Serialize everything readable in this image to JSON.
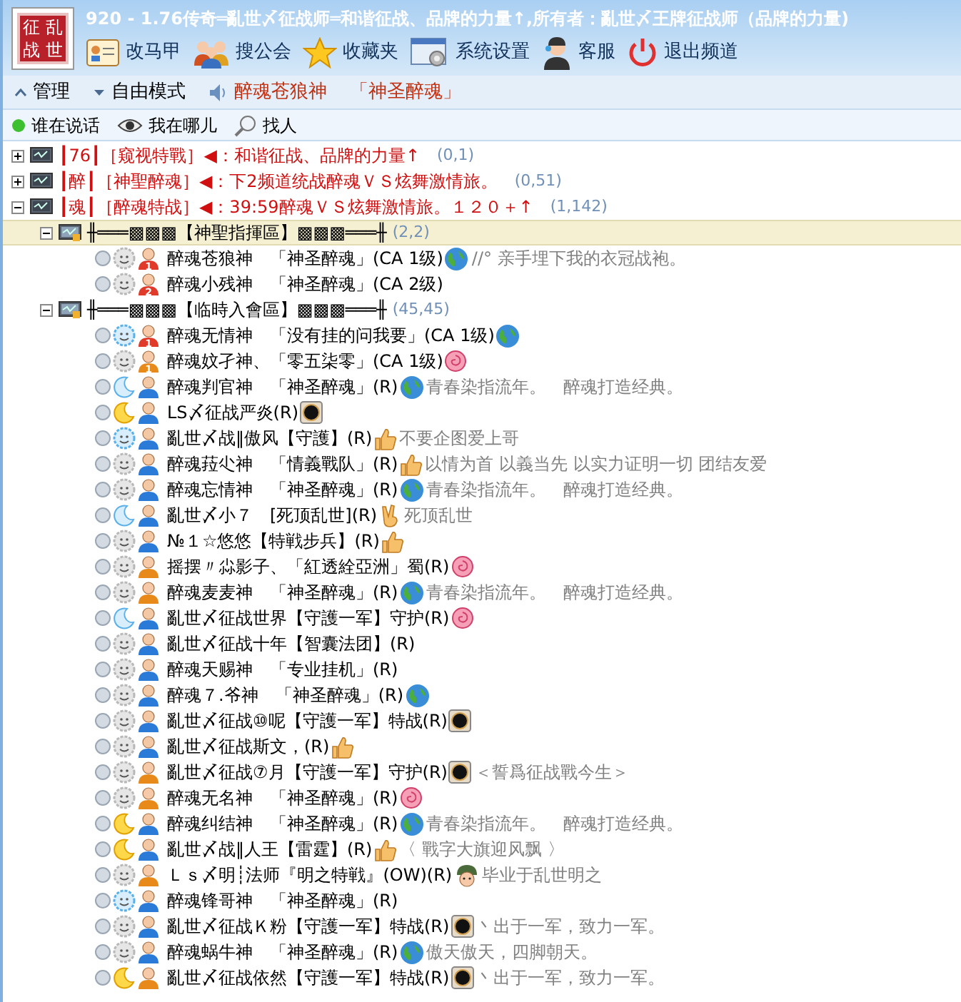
{
  "logo": {
    "chars": [
      "征",
      "乱",
      "战",
      "世"
    ]
  },
  "window": {
    "title": "920 - 1.76传奇═亂世〆征战师═和谐征战、品牌的力量↑,所有者：亂世〆王牌征战师（品牌的力量)"
  },
  "toolbar": [
    {
      "kind": "card",
      "label": "改马甲"
    },
    {
      "kind": "people",
      "label": "搜公会"
    },
    {
      "kind": "star",
      "label": "收藏夹"
    },
    {
      "kind": "settings",
      "label": "系统设置"
    },
    {
      "kind": "support",
      "label": "客服"
    },
    {
      "kind": "power",
      "label": "退出频道"
    }
  ],
  "mode_bar": {
    "manage": "管理",
    "mode": "自由模式",
    "speaker_name": "醉魂苍狼神",
    "speaker_guild": "「神圣醉魂」"
  },
  "view_tabs": [
    {
      "kind": "dot",
      "label": "谁在说话"
    },
    {
      "kind": "eye",
      "label": "我在哪儿"
    },
    {
      "kind": "search",
      "label": "找人"
    }
  ],
  "channels": [
    {
      "name": "┃76┃［窥视特戰］◀：和谐征战、品牌的力量↑",
      "count": "(0,1)",
      "expanded": false
    },
    {
      "name": "┃醉┃［神聖醉魂］◀：下2频道统战醉魂ＶＳ炫舞激情旅。",
      "count": "(0,51)",
      "expanded": false
    },
    {
      "name": "┃魂┃［醉魂特战］◀：39:59醉魂ＶＳ炫舞激情旅。１２０＋↑",
      "count": "(1,142)",
      "expanded": true,
      "children": [
        {
          "name": "╫═══▩▩▩【神聖指揮區】▩▩▩═══╫",
          "count": "(2,2)",
          "expanded": true,
          "selected": true,
          "members": [
            {
              "mood": {
                "kind": "sun_grey"
              },
              "avatar": {
                "kind": "red",
                "rank": "1"
              },
              "name": "醉魂苍狼神　「神圣醉魂」(CA 1级)",
              "badge": {
                "kind": "globe"
              },
              "sign": "//°  亲手埋下我的衣冠战袍。"
            },
            {
              "mood": {
                "kind": "sun_grey"
              },
              "avatar": {
                "kind": "red",
                "rank": "2"
              },
              "name": "醉魂小残神　「神圣醉魂」(CA 2级)"
            }
          ]
        },
        {
          "name": "╫═══▩▩▩【临時入會區】▩▩▩═══╫",
          "count": "(45,45)",
          "expanded": true,
          "selected": false,
          "members": [
            {
              "mood": {
                "kind": "sun_blue"
              },
              "avatar": {
                "kind": "red",
                "rank": "1"
              },
              "name": "醉魂无情神　「没有挂的问我要」(CA 1级)",
              "badge": {
                "kind": "globe"
              }
            },
            {
              "mood": {
                "kind": "sun_grey"
              },
              "avatar": {
                "kind": "orange",
                "rank": "1"
              },
              "name": "醉魂妏孑神、「零五柒零」(CA 1级)",
              "badge": {
                "kind": "rose"
              }
            },
            {
              "mood": {
                "kind": "moon_blue"
              },
              "avatar": {
                "kind": "blue"
              },
              "name": "醉魂判官神　「神圣醉魂」(R)",
              "badge": {
                "kind": "globe"
              },
              "sign": "青春染指流年。　醉魂打造经典。"
            },
            {
              "mood": {
                "kind": "moon_yellow"
              },
              "avatar": {
                "kind": "blue"
              },
              "name": "LS〆征战严炎(R)",
              "badge": {
                "kind": "eclipse"
              }
            },
            {
              "mood": {
                "kind": "sun_blue"
              },
              "avatar": {
                "kind": "blue"
              },
              "name": "亂世〆战‖傲风【守護】(R)",
              "badge": {
                "kind": "thumb"
              },
              "sign": "不要企图爱上哥"
            },
            {
              "mood": {
                "kind": "sun_grey"
              },
              "avatar": {
                "kind": "blue"
              },
              "name": "醉魂菈尐神　「情義戰队」(R)",
              "badge": {
                "kind": "thumb"
              },
              "sign": "以情为首  以義当先  以实力证明一切  团结友爱"
            },
            {
              "mood": {
                "kind": "sun_grey"
              },
              "avatar": {
                "kind": "blue"
              },
              "name": "醉魂忘情神　「神圣醉魂」(R)",
              "badge": {
                "kind": "globe"
              },
              "sign": "青春染指流年。　醉魂打造经典。"
            },
            {
              "mood": {
                "kind": "moon_blue"
              },
              "avatar": {
                "kind": "blue"
              },
              "name": "亂世〆小７　[死顶乱世](R)",
              "badge": {
                "kind": "peace"
              },
              "sign": "死顶乱世"
            },
            {
              "mood": {
                "kind": "sun_grey"
              },
              "avatar": {
                "kind": "blue"
              },
              "name": "№１☆悠悠【特戦步兵】(R)",
              "badge": {
                "kind": "thumb"
              }
            },
            {
              "mood": {
                "kind": "sun_grey"
              },
              "avatar": {
                "kind": "orange"
              },
              "name": "摇摆〃尛影子、「紅透絟亞洲」蜀(R)",
              "badge": {
                "kind": "rose"
              }
            },
            {
              "mood": {
                "kind": "sun_grey"
              },
              "avatar": {
                "kind": "orange"
              },
              "name": "醉魂麦麦神　「神圣醉魂」(R)",
              "badge": {
                "kind": "globe"
              },
              "sign": "青春染指流年。　醉魂打造经典。"
            },
            {
              "mood": {
                "kind": "moon_blue"
              },
              "avatar": {
                "kind": "blue"
              },
              "name": "亂世〆征战世界【守護一军】守护(R)",
              "badge": {
                "kind": "rose"
              }
            },
            {
              "mood": {
                "kind": "sun_grey"
              },
              "avatar": {
                "kind": "blue"
              },
              "name": "亂世〆征战十年【智囊法团】(R)"
            },
            {
              "mood": {
                "kind": "sun_grey"
              },
              "avatar": {
                "kind": "blue"
              },
              "name": "醉魂天赐神　「专业挂机」(R)"
            },
            {
              "mood": {
                "kind": "sun_grey"
              },
              "avatar": {
                "kind": "blue"
              },
              "name": "醉魂７.爷神　「神圣醉魂」(R)",
              "badge": {
                "kind": "globe"
              }
            },
            {
              "mood": {
                "kind": "sun_grey"
              },
              "avatar": {
                "kind": "blue"
              },
              "name": "亂世〆征战⑩呢【守護一军】特战(R)",
              "badge": {
                "kind": "eclipse"
              }
            },
            {
              "mood": {
                "kind": "sun_grey"
              },
              "avatar": {
                "kind": "blue"
              },
              "name": "亂世〆征战斯文，(R)",
              "badge": {
                "kind": "thumb"
              }
            },
            {
              "mood": {
                "kind": "sun_grey"
              },
              "avatar": {
                "kind": "orange"
              },
              "name": "亂世〆征战⑦月【守護一军】守护(R)",
              "badge": {
                "kind": "eclipse"
              },
              "sign": "＜誓爲征战戰今生＞"
            },
            {
              "mood": {
                "kind": "sun_grey"
              },
              "avatar": {
                "kind": "orange"
              },
              "name": "醉魂无名神　「神圣醉魂」(R)",
              "badge": {
                "kind": "rose"
              }
            },
            {
              "mood": {
                "kind": "moon_yellow"
              },
              "avatar": {
                "kind": "blue"
              },
              "name": "醉魂纠结神　「神圣醉魂」(R)",
              "badge": {
                "kind": "globe"
              },
              "sign": "青春染指流年。　醉魂打造经典。"
            },
            {
              "mood": {
                "kind": "moon_yellow"
              },
              "avatar": {
                "kind": "blue"
              },
              "name": "亂世〆战‖人王【雷霆】(R)",
              "badge": {
                "kind": "thumb"
              },
              "sign": "〈 戰字大旗迎风飘 〉"
            },
            {
              "mood": {
                "kind": "sun_grey"
              },
              "avatar": {
                "kind": "orange"
              },
              "name": "Ｌｓ〆明┊法师『明之特戦』(OW)(R)",
              "badge": {
                "kind": "soldier"
              },
              "sign": "毕业于乱世明之"
            },
            {
              "mood": {
                "kind": "sun_blue"
              },
              "avatar": {
                "kind": "blue"
              },
              "name": "醉魂锋哥神　「神圣醉魂」(R)"
            },
            {
              "mood": {
                "kind": "sun_grey"
              },
              "avatar": {
                "kind": "blue"
              },
              "name": "亂世〆征战Ｋ粉【守護一军】特战(R)",
              "badge": {
                "kind": "eclipse"
              },
              "sign": "丶出于一军，致力一军。"
            },
            {
              "mood": {
                "kind": "sun_grey"
              },
              "avatar": {
                "kind": "blue"
              },
              "name": "醉魂蜗牛神　「神圣醉魂」(R)",
              "badge": {
                "kind": "globe"
              },
              "sign": "傲天傲天，四脚朝天。"
            },
            {
              "mood": {
                "kind": "moon_yellow"
              },
              "avatar": {
                "kind": "orange"
              },
              "name": "亂世〆征战依然【守護一军】特战(R)",
              "badge": {
                "kind": "eclipse"
              },
              "sign": "丶出于一军，致力一军。"
            }
          ]
        }
      ]
    }
  ]
}
